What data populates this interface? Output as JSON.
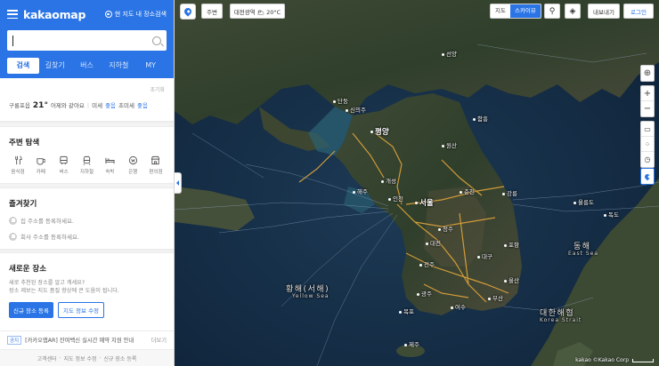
{
  "app": {
    "logo": "kakaomap",
    "area_search": "현 지도 내 장소검색"
  },
  "search": {
    "value": "",
    "placeholder": ""
  },
  "tabs": [
    "검색",
    "길찾기",
    "버스",
    "지하철",
    "MY"
  ],
  "reset_label": "초기화",
  "weather": {
    "location": "구룡포읍",
    "temp": "21°",
    "desc": "어제와 같아요",
    "fine_dust_label": "미세",
    "fine_dust_value": "좋음",
    "ultra_dust_label": "초미세",
    "ultra_dust_value": "좋음"
  },
  "nearby": {
    "title": "주변 탐색",
    "items": [
      {
        "label": "음식점",
        "icon": "food-icon"
      },
      {
        "label": "카페",
        "icon": "cafe-icon"
      },
      {
        "label": "버스",
        "icon": "bus-icon"
      },
      {
        "label": "지하철",
        "icon": "subway-icon"
      },
      {
        "label": "숙박",
        "icon": "bed-icon"
      },
      {
        "label": "은행",
        "icon": "bank-icon"
      },
      {
        "label": "편의점",
        "icon": "store-icon"
      }
    ]
  },
  "favorites": {
    "title": "즐겨찾기",
    "home": "집 주소를 등록하세요.",
    "work": "회사 주소를 등록하세요."
  },
  "new_place": {
    "title": "새로운 장소",
    "desc1": "새로 추천된 장소를 알고 계세요?",
    "desc2": "장소 제보는 지도 품질 향상에 큰 도움이 됩니다.",
    "register_btn": "신규 장소 등록",
    "edit_btn": "지도 정보 수정"
  },
  "notice": {
    "tag": "공지",
    "text": "[카카오맵AR] 잔여백신 실시간 예약 지원 안내",
    "more": "더보기"
  },
  "footer": {
    "links": [
      "고객센터",
      "지도 정보 수정",
      "신규 장소 등록"
    ],
    "sep": "·"
  },
  "map": {
    "toolbar": {
      "nearby": "주변",
      "weather": "대전광역 🌥 20°C",
      "map_label": "지도",
      "skyview_label": "스카이뷰",
      "share_label": "내보내기",
      "login_label": "로그인"
    },
    "places": {
      "pyongyang": "평양",
      "seoul": "서울",
      "dongbu": "동해",
      "dongbu_en": "East Sea",
      "yellow": "황해(서해)",
      "yellow_en": "Yellow Sea",
      "korea_strait": "대한해협",
      "korea_strait_en": "Korea Strait",
      "ulleung": "울릉도",
      "dokdo": "독도",
      "gangneung": "강릉",
      "incheon": "인천",
      "shenyang": "선양",
      "dandong": "단둥",
      "sinuiju": "신의주",
      "jeju": "제주",
      "daegu": "대구",
      "busan": "부산",
      "gwangju": "광주",
      "daejeon": "대전",
      "pohang": "포항",
      "wonsan": "원산",
      "hamhung": "함흥",
      "kaesong": "개성",
      "haeju": "해주",
      "chuncheon": "춘천",
      "cheongju": "청주",
      "jeonju": "전주",
      "mokpo": "목포",
      "ulsan": "울산",
      "yeosu": "여수"
    },
    "scale": "kakao  ©Kakao Corp"
  },
  "colors": {
    "brand": "#2a74e6"
  }
}
